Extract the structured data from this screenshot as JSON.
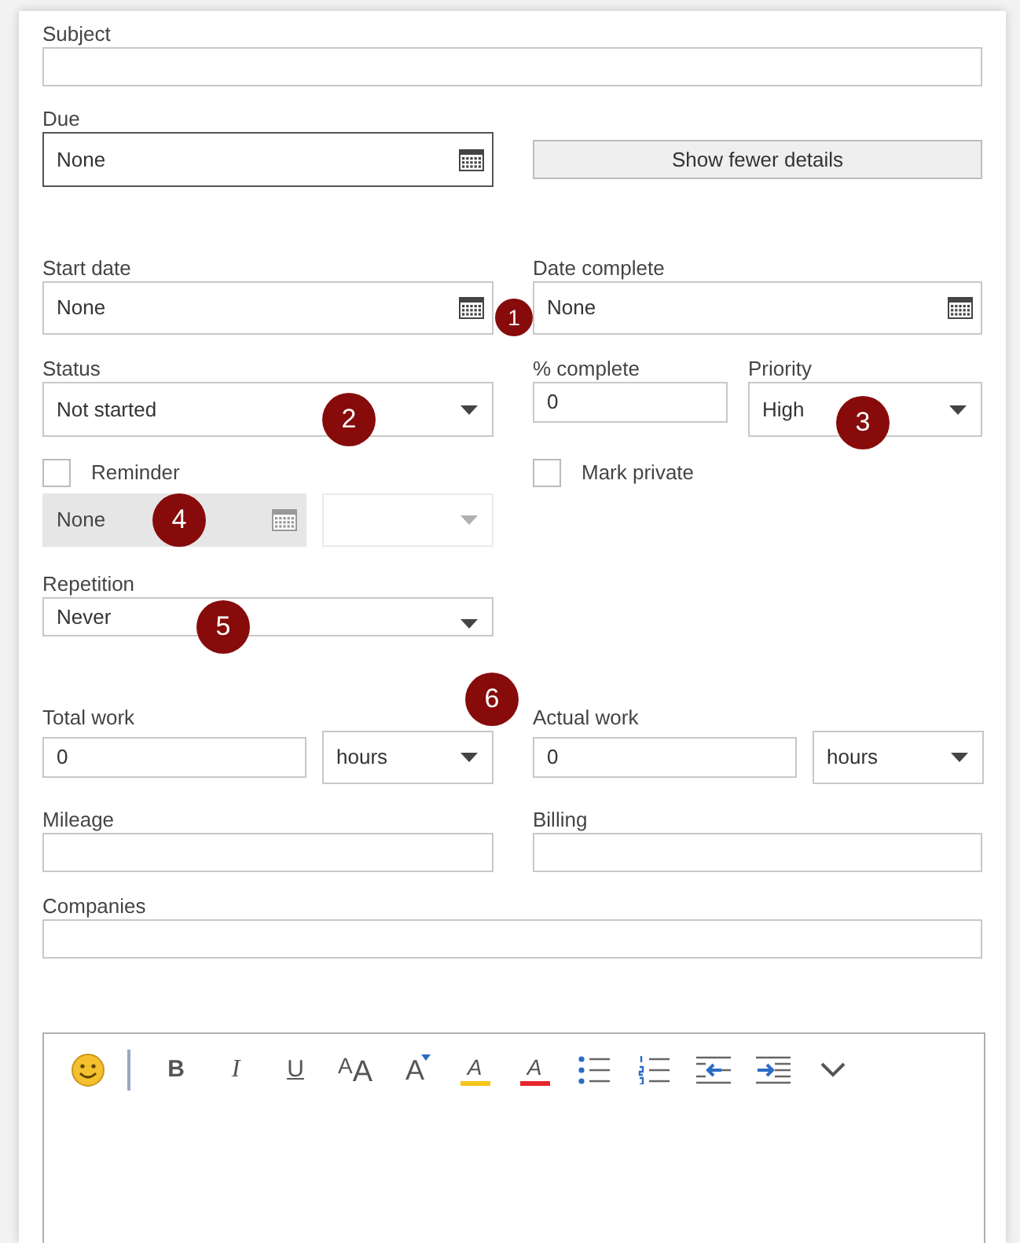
{
  "subject": {
    "label": "Subject"
  },
  "due": {
    "label": "Due",
    "value": "None",
    "focused": true
  },
  "details_button": "Show fewer details",
  "start_date": {
    "label": "Start date",
    "value": "None"
  },
  "date_complete": {
    "label": "Date complete",
    "value": "None"
  },
  "status": {
    "label": "Status",
    "value": "Not started"
  },
  "percent_complete": {
    "label": "% complete",
    "value": "0"
  },
  "priority": {
    "label": "Priority",
    "value": "High"
  },
  "reminder": {
    "label": "Reminder",
    "checked": false,
    "date": "None",
    "disabled": true
  },
  "mark_private": {
    "label": "Mark private",
    "checked": false
  },
  "repetition": {
    "label": "Repetition",
    "value": "Never"
  },
  "total_work": {
    "label": "Total work",
    "value": "0",
    "unit": "hours"
  },
  "actual_work": {
    "label": "Actual work",
    "value": "0",
    "unit": "hours"
  },
  "mileage": {
    "label": "Mileage"
  },
  "billing": {
    "label": "Billing"
  },
  "companies": {
    "label": "Companies"
  },
  "toolbar": [
    {
      "kind": "emoji"
    },
    {
      "kind": "separator"
    },
    {
      "kind": "bold",
      "label": "B"
    },
    {
      "kind": "italic",
      "label": "I"
    },
    {
      "kind": "underline",
      "label": "U"
    },
    {
      "kind": "font-size",
      "label": "AA"
    },
    {
      "kind": "grow-font",
      "label": "A"
    },
    {
      "kind": "highlight",
      "label": "A"
    },
    {
      "kind": "font-color",
      "label": "A"
    },
    {
      "kind": "bullets"
    },
    {
      "kind": "numbering"
    },
    {
      "kind": "outdent"
    },
    {
      "kind": "indent"
    },
    {
      "kind": "more"
    }
  ],
  "callouts": [
    {
      "label": "1"
    },
    {
      "label": "2"
    },
    {
      "label": "3"
    },
    {
      "label": "4"
    },
    {
      "label": "5"
    },
    {
      "label": "6"
    }
  ]
}
